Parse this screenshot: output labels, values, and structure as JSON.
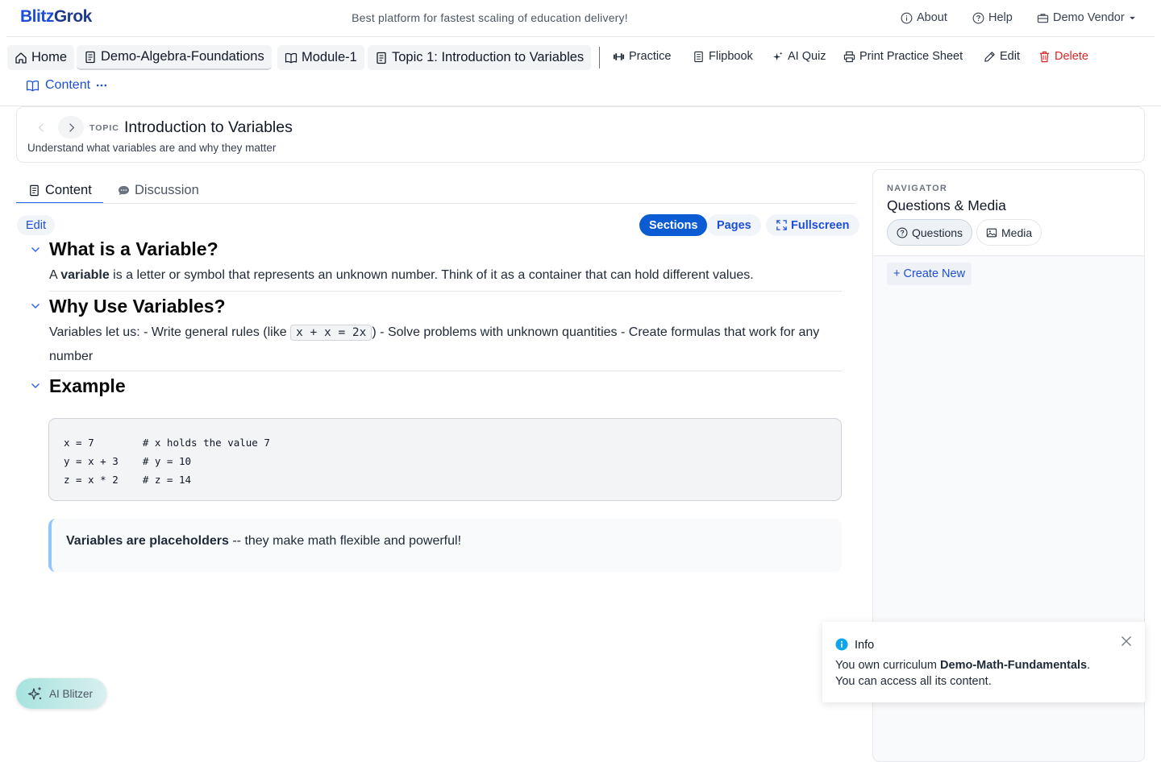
{
  "header": {
    "logo_a": "Blitz",
    "logo_b": "Grok",
    "tagline": "Best platform for fastest scaling of education delivery!",
    "about": "About",
    "help": "Help",
    "vendor": "Demo Vendor"
  },
  "breadcrumbs": [
    "Home",
    "Demo-Algebra-Foundations",
    "Module-1",
    "Topic 1: Introduction to Variables"
  ],
  "toolbar": {
    "practice": "Practice",
    "flipbook": "Flipbook",
    "ai_quiz": "AI Quiz",
    "print": "Print Practice Sheet",
    "edit": "Edit",
    "delete": "Delete",
    "content": "Content"
  },
  "topic": {
    "tag": "TOPIC",
    "title": "Introduction to Variables",
    "subtitle": "Understand what variables are and why they matter"
  },
  "tabs": {
    "content": "Content",
    "discussion": "Discussion"
  },
  "controls": {
    "edit": "Edit",
    "sections": "Sections",
    "pages": "Pages",
    "fullscreen": "Fullscreen"
  },
  "sections": [
    {
      "title": "What is a Variable?",
      "text_a": "A ",
      "text_bold": "variable",
      "text_b": " is a letter or symbol that represents an unknown number. Think of it as a container that can hold different values."
    },
    {
      "title": "Why Use Variables?",
      "text_a": "Variables let us: - Write general rules (like ",
      "code": "x + x = 2x",
      "text_b": ") - Solve problems with unknown quantities - Create formulas that work for any number"
    },
    {
      "title": "Example",
      "code_lines": [
        "x = 7        # x holds the value 7",
        "y = x + 3    # y = 10",
        "z = x * 2    # z = 14"
      ],
      "callout_bold": "Variables are placeholders",
      "callout_text": " -- they make math flexible and powerful!"
    }
  ],
  "navigator": {
    "eyebrow": "NAVIGATOR",
    "title": "Questions & Media",
    "questions": "Questions",
    "media": "Media",
    "create": "+ Create New"
  },
  "toast": {
    "title": "Info",
    "line1_a": "You own curriculum ",
    "line1_bold": "Demo-Math-Fundamentals",
    "line1_b": ".",
    "line2": "You can access all its content."
  },
  "ai": {
    "label": "AI Blitzer"
  },
  "colors": {
    "brand": "#1d4ed8",
    "primary_button": "#0b5bd3",
    "danger": "#dc2626",
    "info": "#0ea5e9"
  }
}
